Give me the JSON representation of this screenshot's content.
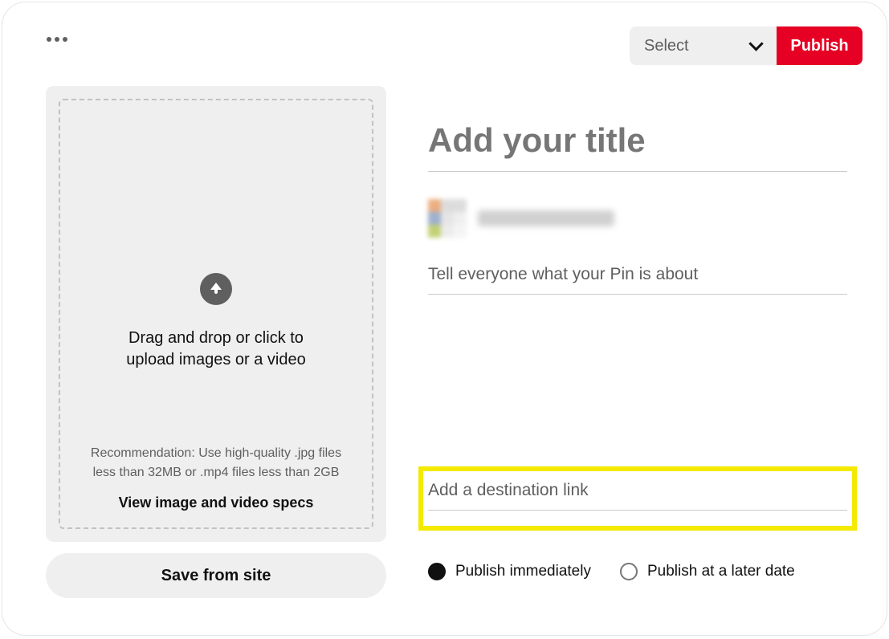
{
  "topbar": {
    "board_select_label": "Select",
    "publish_label": "Publish"
  },
  "upload": {
    "drag_text": "Drag and drop or click to upload images or a video",
    "recommendation": "Recommendation: Use high-quality .jpg files less than 32MB or .mp4 files less than 2GB",
    "specs_link": "View image and video specs"
  },
  "save_from_site_label": "Save from site",
  "form": {
    "title_placeholder": "Add your title",
    "description_placeholder": "Tell everyone what your Pin is about",
    "destination_placeholder": "Add a destination link"
  },
  "publish_options": {
    "immediate_label": "Publish immediately",
    "later_label": "Publish at a later date",
    "selected": "immediate"
  }
}
